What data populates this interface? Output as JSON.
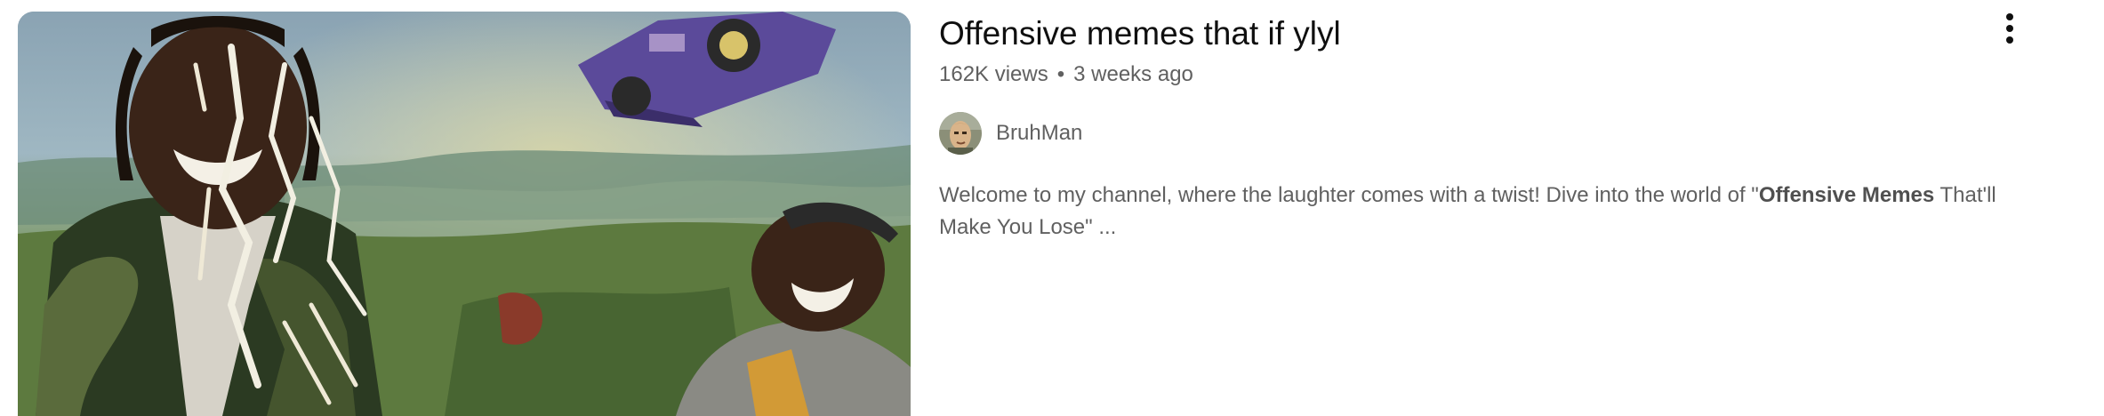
{
  "video": {
    "title": "Offensive memes that if ylyl",
    "views": "162K views",
    "separator": "•",
    "age": "3 weeks ago",
    "channel": {
      "name": "BruhMan"
    },
    "description": {
      "before": "Welcome to my channel, where the laughter comes with a twist! Dive into the world of \"",
      "highlight": "Offensive Memes",
      "after": " That'll Make You Lose\" ..."
    },
    "thumbnail_icon": "video-thumbnail",
    "menu_icon": "more-vert-icon"
  },
  "colors": {
    "title": "#0f0f0f",
    "secondary_text": "#606060",
    "background": "#ffffff"
  }
}
